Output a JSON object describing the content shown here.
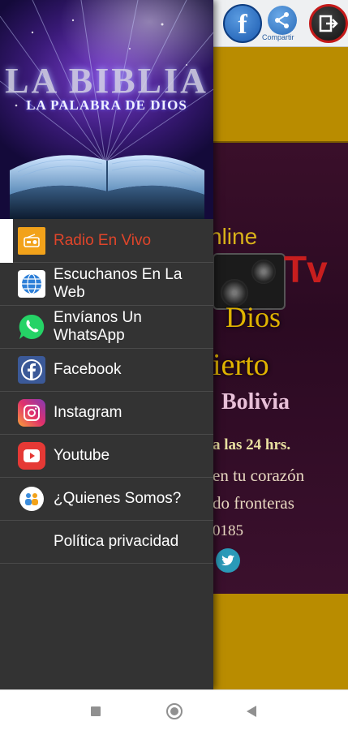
{
  "top_bar": {
    "facebook_icon": "facebook-icon",
    "share_label": "Compartir",
    "exit_icon": "exit-icon"
  },
  "poster": {
    "line1": "nline",
    "line2": "Tv",
    "line3": "Dios",
    "line4": "ierto",
    "line5": "Bolivia",
    "line6": "a las 24 hrs.",
    "line7": "en tu corazón",
    "line8": "do fronteras",
    "line9": "0185"
  },
  "drawer_header": {
    "title": "LA BIBLIA",
    "subtitle": "LA PALABRA DE DIOS"
  },
  "menu": {
    "items": [
      {
        "label": "Radio En Vivo",
        "icon": "radio-icon",
        "active": true
      },
      {
        "label": "Escuchanos En La Web",
        "icon": "globe-icon"
      },
      {
        "label": "Envíanos Un WhatsApp",
        "icon": "whatsapp-icon"
      },
      {
        "label": "Facebook",
        "icon": "facebook-icon"
      },
      {
        "label": "Instagram",
        "icon": "instagram-icon"
      },
      {
        "label": "Youtube",
        "icon": "youtube-icon"
      },
      {
        "label": "¿Quienes Somos?",
        "icon": "people-icon"
      },
      {
        "label": "Política privacidad",
        "icon": ""
      }
    ]
  },
  "colors": {
    "drawer_bg": "#333333",
    "active_label": "#e0452a",
    "app_yellow": "#b98c00"
  },
  "navbar": {
    "recents_icon": "square-icon",
    "home_icon": "circle-icon",
    "back_icon": "triangle-back-icon"
  }
}
